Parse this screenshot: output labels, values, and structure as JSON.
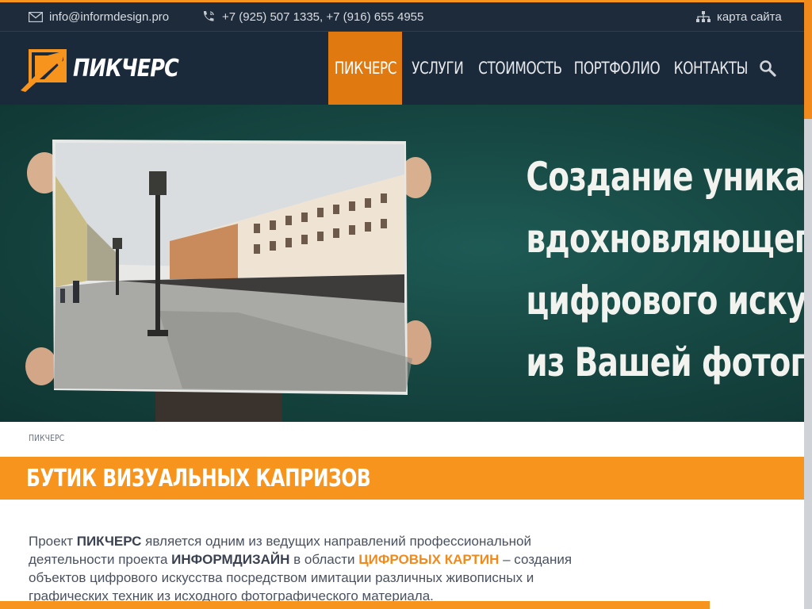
{
  "contact": {
    "email": "info@informdesign.pro",
    "phones": "+7 (925) 507 1335, +7 (916) 655 4955",
    "sitemap_label": "карта сайта"
  },
  "logo": {
    "text": "ПИКЧЕРС"
  },
  "nav": {
    "items": [
      {
        "label": "ПИКЧЕРС",
        "active": true
      },
      {
        "label": "УСЛУГИ",
        "active": false
      },
      {
        "label": "СТОИМОСТЬ",
        "active": false
      },
      {
        "label": "ПОРТФОЛИО",
        "active": false
      },
      {
        "label": "КОНТАКТЫ",
        "active": false
      }
    ],
    "search_icon": "search-icon"
  },
  "hero": {
    "lines": [
      "Создание уникалы",
      "вдохновляющего шед",
      "цифрового искус",
      "из Вашей фотогр"
    ]
  },
  "breadcrumb": "ПИКЧЕРС",
  "title": "БУТИК ВИЗУАЛЬНЫХ КАПРИЗОВ",
  "intro": {
    "t1": "Проект ",
    "b1": "ПИКЧЕРС",
    "t2": " является одним из ведущих направлений профессиональной деятельности проекта ",
    "b2": "ИНФОРМДИЗАЙН",
    "t3": " в области ",
    "b3": "ЦИФРОВЫХ КАРТИН",
    "t4": " – создания объектов цифрового искусства посредством имитации различных живописных и графических техник из исходного фотографического материала."
  },
  "colors": {
    "accent": "#f7941d",
    "nav_bg": "#1b2a3a",
    "hero_bg": "#174843"
  }
}
